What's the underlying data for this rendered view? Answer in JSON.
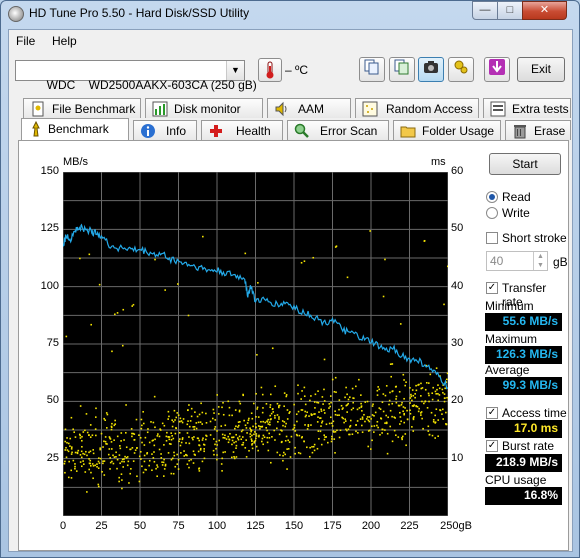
{
  "window": {
    "title": "HD Tune Pro 5.50 - Hard Disk/SSD Utility"
  },
  "caption": {
    "minimize": "—",
    "maximize": "□",
    "close": "✕"
  },
  "menu": {
    "file": "File",
    "help": "Help"
  },
  "toolbar": {
    "drive": "WDC    WD2500AAKX-603CA (250 gB)",
    "temperature": "– ºC",
    "exit_label": "Exit",
    "icons": [
      "copy-icon",
      "copy-all-icon",
      "screenshot-icon",
      "options-icon",
      "save-icon"
    ]
  },
  "tabs_top": [
    {
      "label": "File Benchmark",
      "icon": "file-benchmark-icon"
    },
    {
      "label": "Disk monitor",
      "icon": "disk-monitor-icon"
    },
    {
      "label": "AAM",
      "icon": "speaker-icon"
    },
    {
      "label": "Random Access",
      "icon": "random-access-icon"
    },
    {
      "label": "Extra tests",
      "icon": "extra-tests-icon"
    }
  ],
  "tabs_bottom": [
    {
      "label": "Benchmark",
      "icon": "benchmark-icon",
      "selected": true
    },
    {
      "label": "Info",
      "icon": "info-icon"
    },
    {
      "label": "Health",
      "icon": "health-icon"
    },
    {
      "label": "Error Scan",
      "icon": "error-scan-icon"
    },
    {
      "label": "Folder Usage",
      "icon": "folder-icon"
    },
    {
      "label": "Erase",
      "icon": "trash-icon"
    }
  ],
  "side": {
    "start_label": "Start",
    "read_label": "Read",
    "write_label": "Write",
    "read_selected": true,
    "short_stroke_label": "Short stroke",
    "short_stroke_checked": false,
    "stroke_value": "40",
    "stroke_unit": "gB",
    "transfer_rate_label": "Transfer rate",
    "transfer_rate_checked": true,
    "minimum_label": "Minimum",
    "minimum_value": "55.6 MB/s",
    "maximum_label": "Maximum",
    "maximum_value": "126.3 MB/s",
    "average_label": "Average",
    "average_value": "99.3 MB/s",
    "access_time_label": "Access time",
    "access_time_checked": true,
    "access_time_value": "17.0 ms",
    "burst_rate_label": "Burst rate",
    "burst_rate_checked": true,
    "burst_rate_value": "218.9 MB/s",
    "cpu_usage_label": "CPU usage",
    "cpu_usage_value": "16.8%"
  },
  "chart_data": {
    "type": "line",
    "left_unit": "MB/s",
    "right_unit": "ms",
    "x_ticks": [
      "0",
      "25",
      "50",
      "75",
      "100",
      "125",
      "150",
      "175",
      "200",
      "225",
      "250gB"
    ],
    "y_left_ticks": [
      "150",
      "125",
      "100",
      "75",
      "50",
      "25"
    ],
    "y_right_ticks": [
      "60",
      "50",
      "40",
      "30",
      "20",
      "10"
    ],
    "xlim": [
      0,
      250
    ],
    "ylim_left": [
      0,
      150
    ],
    "ylim_right": [
      0,
      60
    ],
    "grid": true,
    "colors": {
      "transfer": "#23a9e8",
      "access": "#f4e400",
      "background": "#000000",
      "grid": "#6a6a6a"
    },
    "series": [
      {
        "name": "Transfer rate",
        "axis": "left",
        "x": [
          0,
          2,
          5,
          8,
          10,
          12,
          15,
          18,
          20,
          22,
          25,
          30,
          35,
          40,
          45,
          50,
          55,
          60,
          65,
          70,
          75,
          80,
          85,
          90,
          95,
          100,
          105,
          110,
          115,
          118,
          120,
          122,
          125,
          130,
          135,
          140,
          145,
          150,
          155,
          160,
          165,
          170,
          175,
          180,
          185,
          190,
          195,
          200,
          205,
          210,
          215,
          220,
          225,
          230,
          235,
          240,
          245,
          250
        ],
        "y": [
          118,
          122,
          121,
          125,
          125,
          126,
          124,
          125,
          123,
          124,
          122,
          118,
          117,
          117,
          116,
          116,
          115,
          114,
          114,
          112,
          111,
          110,
          109,
          108,
          107,
          107,
          106,
          105,
          104,
          104,
          96,
          100,
          94,
          94,
          93,
          92,
          93,
          91,
          89,
          88,
          86,
          84,
          86,
          82,
          80,
          79,
          77,
          76,
          74,
          72,
          73,
          70,
          68,
          68,
          66,
          63,
          60,
          56
        ]
      },
      {
        "name": "Access time",
        "axis": "right",
        "style": "scatter",
        "note_center_ms": [
          14,
          15,
          16,
          17,
          18,
          19,
          20,
          21,
          22,
          23
        ]
      }
    ]
  }
}
